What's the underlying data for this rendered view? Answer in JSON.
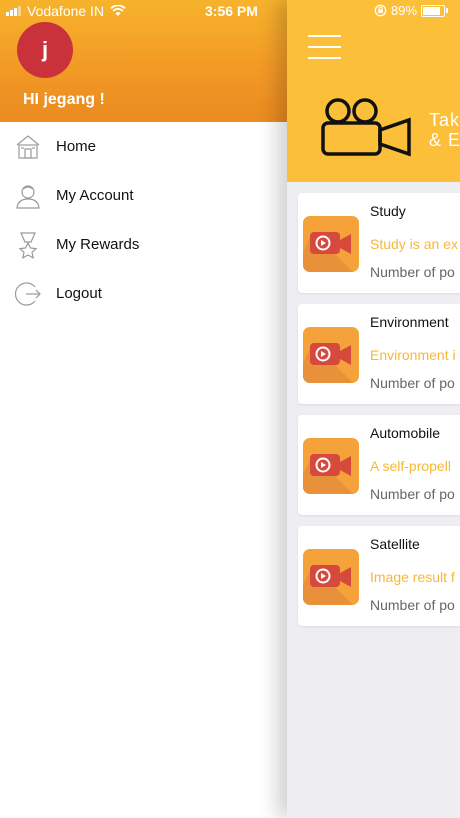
{
  "status": {
    "carrier": "Vodafone IN",
    "time": "3:56 PM",
    "battery": "89%"
  },
  "drawer": {
    "avatar_letter": "j",
    "greeting": "HI jegang !",
    "items": [
      {
        "label": "Home",
        "icon": "home-icon"
      },
      {
        "label": "My Account",
        "icon": "user-icon"
      },
      {
        "label": "My Rewards",
        "icon": "trophy-icon"
      },
      {
        "label": "Logout",
        "icon": "logout-icon"
      }
    ]
  },
  "main": {
    "banner_line1": "Tak",
    "banner_line2": "& E",
    "colors": {
      "header": "#fcbf3a",
      "accent": "#f8b73a",
      "thumb": "#f6a23a",
      "camera": "#d64a3e"
    },
    "cards": [
      {
        "title": "Study",
        "desc": "Study is an ex",
        "meta": "Number of po"
      },
      {
        "title": "Environment",
        "desc": "Environment i",
        "meta": "Number of po"
      },
      {
        "title": "Automobile",
        "desc": "A self-propell",
        "meta": "Number of po"
      },
      {
        "title": "Satellite",
        "desc": "Image result f",
        "meta": "Number of po"
      }
    ]
  }
}
